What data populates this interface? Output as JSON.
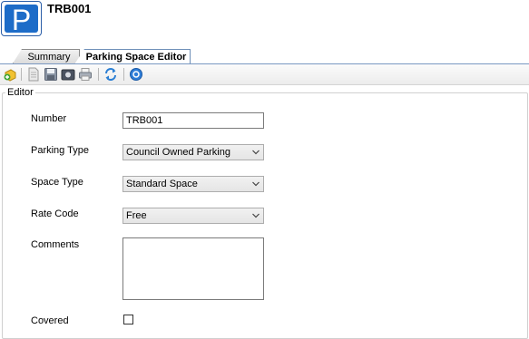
{
  "header": {
    "title": "TRB001",
    "app_icon": "parking-icon",
    "app_icon_letter": "P"
  },
  "tabs": [
    {
      "label": "Summary",
      "active": false
    },
    {
      "label": "Parking Space Editor",
      "active": true
    }
  ],
  "toolbar": {
    "buttons": [
      "add-icon",
      "document-icon",
      "save-icon",
      "camera-icon",
      "print-icon",
      "refresh-icon",
      "help-icon"
    ]
  },
  "editor": {
    "group_title": "Editor",
    "number": {
      "label": "Number",
      "value": "TRB001"
    },
    "parking_type": {
      "label": "Parking Type",
      "value": "Council Owned Parking"
    },
    "space_type": {
      "label": "Space Type",
      "value": "Standard Space"
    },
    "rate_code": {
      "label": "Rate Code",
      "value": "Free"
    },
    "comments": {
      "label": "Comments",
      "value": ""
    },
    "covered": {
      "label": "Covered",
      "checked": false
    }
  },
  "colors": {
    "accent": "#1d6cc8",
    "tab_border": "#7a98c2"
  }
}
